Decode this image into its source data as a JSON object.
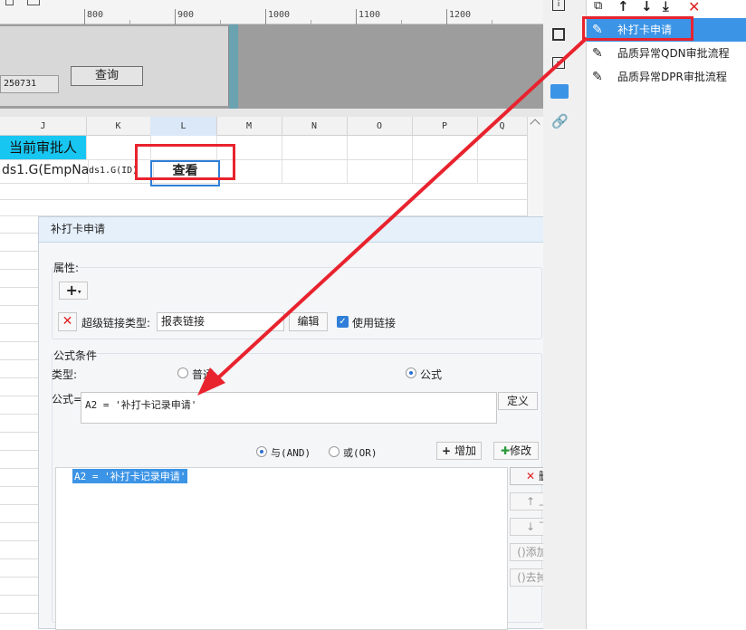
{
  "ruler": {
    "ticks": [
      "800",
      "900",
      "1000",
      "1100",
      "1200"
    ]
  },
  "preview": {
    "date_value": "250731",
    "query_label": "查询"
  },
  "grid": {
    "columns": [
      "J",
      "K",
      "L",
      "M",
      "N",
      "O",
      "P",
      "Q"
    ],
    "selected_column": "L",
    "row1": {
      "approver_header": "当前审批人"
    },
    "row2": {
      "empname_formula": "ds1.G(EmpNa",
      "id_formula": "ds1.G(ID)",
      "view_label": "查看"
    }
  },
  "dialog": {
    "title": "补打卡申请",
    "properties_label": "属性:",
    "hyperlink_type_label": "超级链接类型:",
    "hyperlink_type_value": "报表链接",
    "edit_label": "编辑",
    "use_link_label": "使用链接",
    "use_link_checked": true,
    "formula_section_label": "公式条件",
    "type_label": "类型:",
    "type_normal_label": "普通",
    "type_formula_label": "公式",
    "type_selected": "formula",
    "formula_label": "公式=",
    "formula_value": "A2 = '补打卡记录申请'",
    "define_label": "定义",
    "and_label": "与(AND)",
    "or_label": "或(OR)",
    "logic_selected": "AND",
    "add_label": "增加",
    "modify_label": "修改",
    "conditions": [
      "A2 = '补打卡记录申请'"
    ],
    "delete_label": "删除",
    "move_up_label": "上移",
    "move_down_label": "下移",
    "add_bracket_label": "添加括号",
    "remove_bracket_label": "去掉括号"
  },
  "right_panel": {
    "items": [
      "补打卡申请",
      "品质异常QDN审批流程",
      "品质异常DPR审批流程"
    ],
    "selected_index": 0
  },
  "colors": {
    "accent_blue": "#3c94e6",
    "highlight_red": "#e8232e",
    "cyan_header": "#18c6f2"
  },
  "icons": [
    "copy-icon",
    "arrow-up-icon",
    "arrow-down-icon",
    "move-bottom-icon",
    "delete-x-icon",
    "pencil-icon",
    "info-icon",
    "square-icon",
    "dropdown-box-icon",
    "form-icon",
    "link-icon",
    "plus-icon",
    "check-icon"
  ]
}
